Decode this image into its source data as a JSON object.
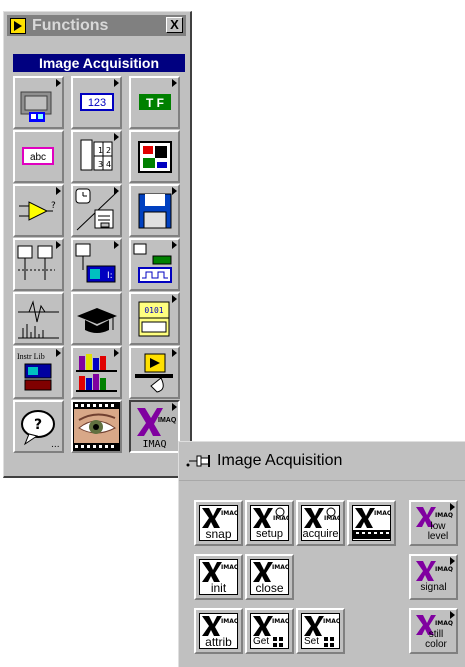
{
  "functions_palette": {
    "title": "Functions",
    "close_label": "X",
    "subpalette_title": "Image Acquisition",
    "items": [
      {
        "name": "structures",
        "text": ""
      },
      {
        "name": "numeric",
        "text": "123"
      },
      {
        "name": "boolean",
        "text": "T F"
      },
      {
        "name": "string",
        "text": "abc"
      },
      {
        "name": "array-cluster",
        "text": ""
      },
      {
        "name": "cluster",
        "text": ""
      },
      {
        "name": "comparison",
        "text": ""
      },
      {
        "name": "time-dialog",
        "text": ""
      },
      {
        "name": "file-io",
        "text": ""
      },
      {
        "name": "data-acquisition",
        "text": ""
      },
      {
        "name": "daq-waveform",
        "text": ""
      },
      {
        "name": "daq-pulse",
        "text": ""
      },
      {
        "name": "analysis",
        "text": ""
      },
      {
        "name": "tutorial",
        "text": ""
      },
      {
        "name": "communication",
        "text": ""
      },
      {
        "name": "instrument-io",
        "text": "Instr Lib"
      },
      {
        "name": "user-libraries",
        "text": ""
      },
      {
        "name": "select-vi",
        "text": ""
      },
      {
        "name": "help",
        "text": ""
      },
      {
        "name": "image-acquisition-eye",
        "text": ""
      },
      {
        "name": "imaq",
        "text": "IMAQ"
      }
    ]
  },
  "image_acquisition": {
    "title": "Image Acquisition",
    "imaq_tag": "IMAQ",
    "items": [
      {
        "label": "snap"
      },
      {
        "label": "setup"
      },
      {
        "label": "acquire"
      },
      {
        "label": ""
      },
      {
        "label": "low level"
      },
      {
        "label": "init"
      },
      {
        "label": "close"
      },
      {
        "label": "signal"
      },
      {
        "label": "attrib"
      },
      {
        "label": "Get"
      },
      {
        "label": "Set"
      },
      {
        "label": "still color"
      }
    ]
  },
  "colors": {
    "window_gray": "#c0c0c0",
    "title_inactive": "#808080",
    "subpalette_navy": "#000080",
    "imaq_purple": "#8000a0"
  }
}
